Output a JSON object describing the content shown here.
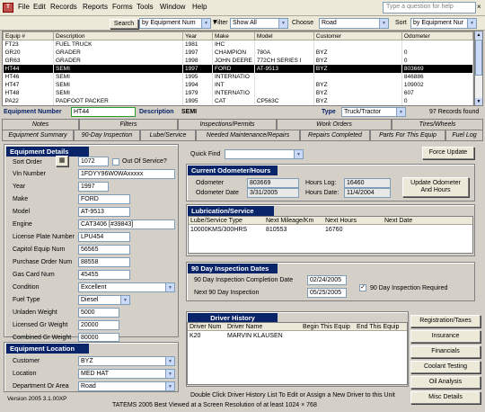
{
  "menu": {
    "app_icon": "T",
    "items": [
      "File",
      "Edit",
      "Records",
      "Reports",
      "Forms",
      "Tools",
      "Window",
      "Help"
    ],
    "help_placeholder": "Type a question for help",
    "close": "×"
  },
  "toolbar": {
    "search_label": "Search",
    "search_by": "by Equipment Num",
    "filter_label": "Filter",
    "filter_value": "Show All",
    "choose_label": "Choose",
    "choose_value": "Road",
    "sort_label": "Sort",
    "sort_value": "by Equipment Nur"
  },
  "grid": {
    "columns": [
      "Equip #",
      "Description",
      "Year",
      "Make",
      "Model",
      "Customer",
      "Odometer"
    ],
    "rows": [
      [
        "FT23",
        "FUEL TRUCK",
        "1981",
        "IHC",
        "",
        "",
        ""
      ],
      [
        "GR20",
        "GRADER",
        "1997",
        "CHAMPION",
        "780A",
        "BYZ",
        "0"
      ],
      [
        "GR63",
        "GRADER",
        "1998",
        "JOHN DEERE",
        "772CH SERIES I",
        "BYZ",
        "0"
      ],
      [
        "HT44",
        "SEMI",
        "1997",
        "FORD",
        "AT-9513",
        "BYZ",
        "803669"
      ],
      [
        "HT46",
        "SEMI",
        "1995",
        "INTERNATIO",
        "",
        "",
        "846886"
      ],
      [
        "HT47",
        "SEMI",
        "1994",
        "INT",
        "",
        "BYZ",
        "109002"
      ],
      [
        "HT48",
        "SEMI",
        "1979",
        "INTERNATIO",
        "",
        "BYZ",
        "607"
      ],
      [
        "PA22",
        "PADFOOT PACKER",
        "1995",
        "CAT",
        "CP563C",
        "BYZ",
        "0"
      ]
    ],
    "selected_index": 3
  },
  "equip_bar": {
    "number_label": "Equipment Number",
    "number_value": "HT44",
    "desc_label": "Description",
    "desc_value": "SEMI",
    "type_label": "Type",
    "type_value": "Truck/Tractor",
    "records": "97 Records found"
  },
  "tabs_row1": [
    "Notes",
    "Filters",
    "Inspections/Permits",
    "Work Orders",
    "Tires/Wheels"
  ],
  "tabs_row2": [
    "Equipment Summary",
    "90-Day Inspection",
    "Lube/Service",
    "Needed Maintenance/Repairs",
    "Repairs Completed",
    "Parts For This Equip",
    "Fuel Log"
  ],
  "details": {
    "title": "Equipment Details",
    "sort_order_label": "Sort Order",
    "sort_order_value": "1072",
    "out_of_service": "Out Of Service?",
    "vin_label": "Vin Number",
    "vin_value": "1FDYY96W0WAxxxxx",
    "year_label": "Year",
    "year_value": "1997",
    "make_label": "Make",
    "make_value": "FORD",
    "model_label": "Model",
    "model_value": "AT-9513",
    "engine_label": "Engine",
    "engine_value": "CAT3406 [#39843]",
    "plate_label": "License Plate Number",
    "plate_value": "LPU454",
    "capitol_label": "Capitol Equip Num",
    "capitol_value": "56565",
    "po_label": "Purchase Order Num",
    "po_value": "88558",
    "gas_label": "Gas Card Num",
    "gas_value": "45455",
    "condition_label": "Condition",
    "condition_value": "Excellent",
    "fuel_label": "Fuel Type",
    "fuel_value": "Diesel",
    "unladen_label": "Unladen Weight",
    "unladen_value": "5000",
    "licgr_label": "Licensed Gr Weight",
    "licgr_value": "20000",
    "combgr_label": "Combined Gr Weight",
    "combgr_value": "80000"
  },
  "location": {
    "title": "Equipment Location",
    "customer_label": "Customer",
    "customer_value": "BYZ",
    "location_label": "Location",
    "location_value": "MED HAT",
    "dept_label": "Department Or Area",
    "dept_value": "Road"
  },
  "version": "Version 2005 3.1.00XP",
  "quick_find_label": "Quick Find",
  "force_update": "Force Update",
  "odometer": {
    "title": "Current Odometer/Hours",
    "odo_label": "Odometer",
    "odo_value": "803669",
    "odo_date_label": "Odometer Date",
    "odo_date_value": "3/31/2005",
    "hours_log_label": "Hours Log:",
    "hours_log_value": "16460",
    "hours_date_label": "Hours Date:",
    "hours_date_value": "11/4/2004",
    "update_btn_1": "Update Odometer",
    "update_btn_2": "And Hours"
  },
  "lube": {
    "title": "Lubrication/Service",
    "columns": [
      "Lube/Service Type",
      "Next Mileage/Km",
      "Next Hours",
      "Next Date"
    ],
    "row": [
      "10000KMS/300HRS",
      "810553",
      "16760",
      ""
    ]
  },
  "inspection": {
    "title": "90 Day Inspection Dates",
    "completion_label": "90 Day Inspection Completion Date",
    "completion_value": "02/24/2005",
    "next_label": "Next 90 Day Inspection",
    "next_value": "05/25/2005",
    "required_label": "90 Day Inspection Required",
    "required_check": "✓"
  },
  "driver": {
    "title": "Driver History",
    "columns": [
      "Driver Num",
      "Driver Name",
      "Begin This Equip",
      "End This Equip"
    ],
    "row": [
      "K20",
      "MARVIN KLAUSEN",
      "",
      ""
    ],
    "hint": "Double Click Driver History List To Edit or Assign a New Driver to this Unit"
  },
  "side_buttons": [
    "Registration/Taxes",
    "Insurance",
    "Financials",
    "Coolant Testing",
    "Oil Analysis",
    "Misc Details"
  ],
  "footer": "TATEMS 2005 Best Viewed at a Screen Resolution of at least 1024 × 768"
}
